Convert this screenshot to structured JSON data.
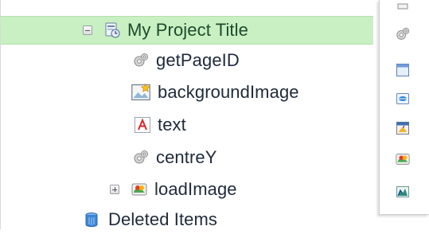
{
  "tree": {
    "project": {
      "label": "My Project Title",
      "expanded": true
    },
    "children": [
      {
        "label": "getPageID",
        "icon": "gear-icon"
      },
      {
        "label": "backgroundImage",
        "icon": "image-star-icon"
      },
      {
        "label": "text",
        "icon": "text-a-icon"
      },
      {
        "label": "centreY",
        "icon": "gear-icon"
      },
      {
        "label": "loadImage",
        "icon": "colorful-block-icon",
        "expanded": false
      }
    ],
    "deleted": {
      "label": "Deleted Items",
      "icon": "trash-can-icon"
    }
  },
  "side_toolbar": {
    "buttons": [
      "minimize-bar-icon",
      "gear-icon",
      "window-icon",
      "globe-link-icon",
      "dashboard-icon",
      "colorful-block-icon",
      "chart-image-icon"
    ]
  }
}
